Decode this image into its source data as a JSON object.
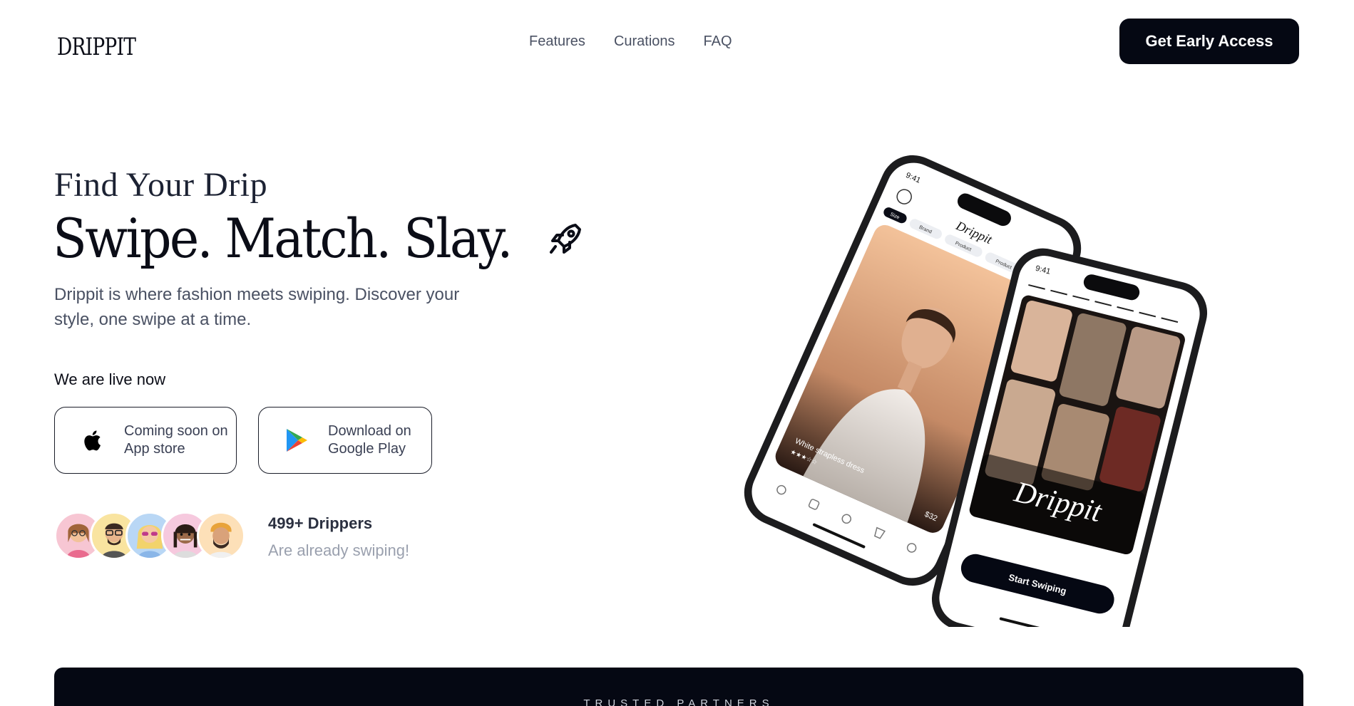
{
  "header": {
    "logo": "DRIPPIT",
    "nav": [
      "Features",
      "Curations",
      "FAQ"
    ],
    "cta": "Get Early Access"
  },
  "hero": {
    "tagline": "Find Your Drip",
    "headline": "Swipe. Match. Slay.",
    "description": "Drippit is where fashion meets swiping. Discover your style, one swipe at a time.",
    "live_label": "We are live now",
    "app_store": {
      "label": "Coming soon on\nApp store",
      "icon": "apple-icon"
    },
    "google_play": {
      "label": "Download on\nGoogle Play",
      "icon": "google-play-icon"
    },
    "social_proof": {
      "count": "499+ Drippers",
      "sub": "Are already swiping!"
    }
  },
  "phone_left": {
    "time": "9:41",
    "app_title": "Drippit",
    "filters": [
      "Size",
      "Brand",
      "Product",
      "Product",
      "Pr"
    ],
    "product_name": "White strapless dress",
    "price": "$32"
  },
  "phone_right": {
    "time": "9:41",
    "brand": "Drippit",
    "button": "Start Swiping"
  },
  "partners": {
    "label": "TRUSTED PARTNERS"
  },
  "colors": {
    "dark": "#050813",
    "text_muted": "#4a5163",
    "avatar_bgs": [
      "#f7c6d3",
      "#f9e4a0",
      "#b9d7f5",
      "#f6c9de",
      "#fde0b8"
    ]
  }
}
